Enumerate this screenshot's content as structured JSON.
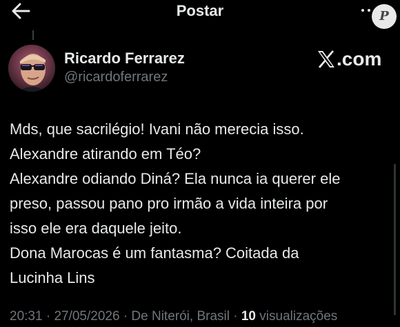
{
  "header": {
    "title": "Postar",
    "back_icon": "arrow-left-icon",
    "more_icon": "more-dots-icon",
    "watermark_icon": "p-badge-icon"
  },
  "author": {
    "display_name": "Ricardo Ferrarez",
    "handle": "@ricardoferrarez",
    "avatar": "avatar-photo"
  },
  "brand": {
    "logo_icon": "x-logo-icon",
    "suffix": ".com"
  },
  "post": {
    "lines": [
      "Mds, que sacrilégio! Ivani não merecia isso.",
      "Alexandre atirando em Téo?",
      "Alexandre odiando Diná? Ela nunca ia querer ele",
      "preso, passou pano pro irmão a vida inteira por",
      "isso ele era daquele jeito.",
      "Dona Marocas é um fantasma? Coitada da",
      "Lucinha Lins"
    ]
  },
  "meta": {
    "time": "20:31",
    "sep1": " · ",
    "date": "27/05/2026",
    "sep2": " · ",
    "location": "De Niterói, Brasil",
    "sep3": " · ",
    "views_count": "10",
    "views_label": " visualizações"
  },
  "colors": {
    "background": "#000000",
    "text_primary": "#e7e9ea",
    "text_secondary": "#71767b"
  }
}
